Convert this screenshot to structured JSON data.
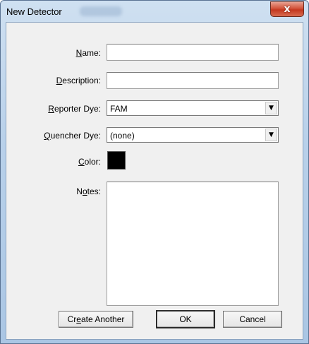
{
  "window": {
    "title": "New Detector",
    "close_glyph": "x"
  },
  "form": {
    "name": {
      "label_pre": "",
      "label_key": "N",
      "label_post": "ame:",
      "value": ""
    },
    "description": {
      "label_pre": "",
      "label_key": "D",
      "label_post": "escription:",
      "value": ""
    },
    "reporter_dye": {
      "label_pre": "",
      "label_key": "R",
      "label_post": "eporter Dye:",
      "value": "FAM"
    },
    "quencher_dye": {
      "label_pre": "",
      "label_key": "Q",
      "label_post": "uencher Dye:",
      "value": "(none)"
    },
    "color": {
      "label_pre": "",
      "label_key": "C",
      "label_post": "olor:",
      "value": "#000000"
    },
    "notes": {
      "label_pre": "N",
      "label_key": "o",
      "label_post": "tes:",
      "value": ""
    }
  },
  "buttons": {
    "create_another": {
      "pre": "Cr",
      "key": "e",
      "post": "ate Another"
    },
    "ok": "OK",
    "cancel": "Cancel"
  },
  "icons": {
    "close": "close-icon",
    "dropdown": "chevron-down-icon"
  }
}
